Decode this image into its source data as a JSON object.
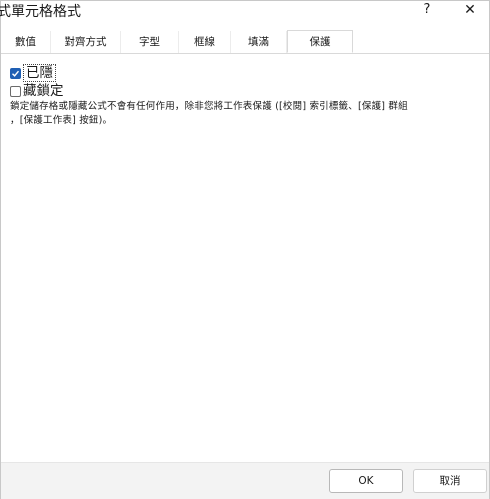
{
  "window": {
    "title": "式單元格格式",
    "help_label": "?",
    "close_label": "✕"
  },
  "tabs": [
    {
      "label": "數值",
      "active": false
    },
    {
      "label": "對齊方式",
      "active": false
    },
    {
      "label": "字型",
      "active": false
    },
    {
      "label": "框線",
      "active": false
    },
    {
      "label": "填滿",
      "active": false
    },
    {
      "label": "保護",
      "active": true
    }
  ],
  "protection": {
    "hidden": {
      "label": "已隱",
      "checked": true
    },
    "locked": {
      "label": "藏鎖定",
      "checked": false
    },
    "description_line1": "鎖定儲存格或隱藏公式不會有任何作用，除非您將工作表保護 ([校閱] 索引標籤、[保護] 群組",
    "description_line2": "，[保護工作表] 按鈕)。"
  },
  "footer": {
    "ok_label": "OK",
    "cancel_label": "取消"
  },
  "colors": {
    "accent": "#1f5fb4",
    "footer_bg": "#f3f3f3"
  }
}
